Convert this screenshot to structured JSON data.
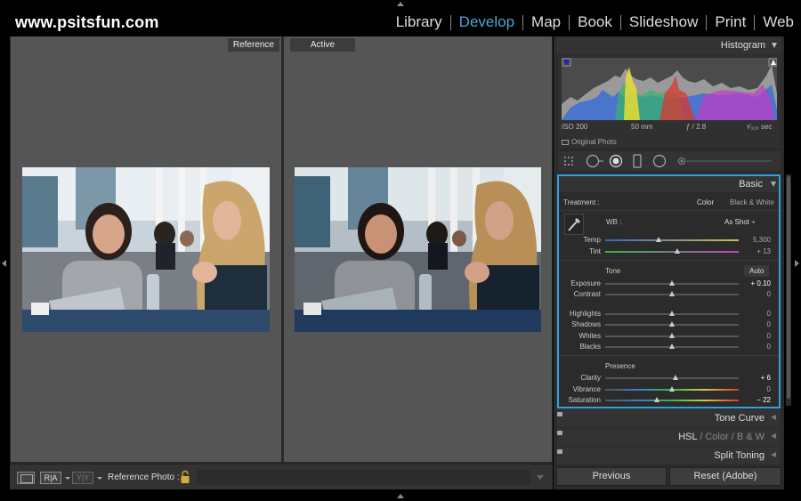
{
  "app": {
    "brand": "www.psitsfun.com"
  },
  "modules": [
    "Library",
    "Develop",
    "Map",
    "Book",
    "Slideshow",
    "Print",
    "Web"
  ],
  "active_module": "Develop",
  "center": {
    "reference_label": "Reference",
    "active_label": "Active",
    "toolbar": {
      "ra_label": "R|A",
      "yy_label": "Y|Y",
      "reference_photo_label": "Reference Photo :"
    }
  },
  "histogram": {
    "title": "Histogram",
    "iso": "ISO 200",
    "focal": "50 mm",
    "aperture": "ƒ / 2.8",
    "shutter": "¹⁄₃₂₀ sec",
    "original_photo": "Original Photo"
  },
  "basic": {
    "title": "Basic",
    "treatment_label": "Treatment :",
    "color_label": "Color",
    "bw_label": "Black & White",
    "wb_label": "WB :",
    "wb_value": "As Shot ÷",
    "tone_label": "Tone",
    "auto_label": "Auto",
    "presence_label": "Presence",
    "sliders": [
      {
        "label": "Temp",
        "value": "5,300",
        "fraction": 0.4
      },
      {
        "label": "Tint",
        "value": "+ 13",
        "fraction": 0.54
      },
      {
        "label": "Exposure",
        "value": "+ 0.10",
        "fraction": 0.5
      },
      {
        "label": "Contrast",
        "value": "0",
        "fraction": 0.5
      },
      {
        "label": "Highlights",
        "value": "0",
        "fraction": 0.5
      },
      {
        "label": "Shadows",
        "value": "0",
        "fraction": 0.5
      },
      {
        "label": "Whites",
        "value": "0",
        "fraction": 0.5
      },
      {
        "label": "Blacks",
        "value": "0",
        "fraction": 0.5
      },
      {
        "label": "Clarity",
        "value": "+ 6",
        "fraction": 0.53
      },
      {
        "label": "Vibrance",
        "value": "0",
        "fraction": 0.5
      },
      {
        "label": "Saturation",
        "value": "− 22",
        "fraction": 0.39
      }
    ]
  },
  "sections": {
    "tone_curve": "Tone Curve",
    "hsl": "HSL",
    "color": "Color",
    "bw": "B & W",
    "split_toning": "Split Toning"
  },
  "buttons": {
    "previous": "Previous",
    "reset": "Reset (Adobe)"
  },
  "colors": {
    "accent": "#4aa6d9",
    "highlight_border": "#2fa3e0"
  }
}
